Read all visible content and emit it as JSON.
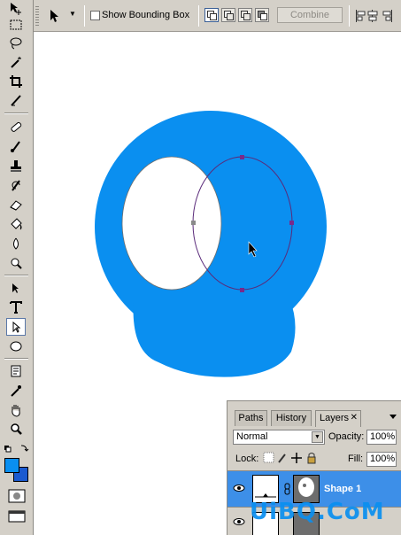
{
  "options_bar": {
    "tool_icon": "direct-selection-arrow-icon",
    "show_bounding_box_label": "Show Bounding Box",
    "show_bounding_box_checked": false,
    "path_modes": [
      "add-to-shape-area",
      "subtract-from-shape-area",
      "intersect-shape-areas",
      "exclude-overlapping-shape-areas"
    ],
    "combine_label": "Combine",
    "align_icons": "align-distribute-icons"
  },
  "toolbox": {
    "tools": [
      "move",
      "marquee",
      "lasso",
      "magic-wand",
      "crop",
      "slice",
      "healing-brush",
      "brush",
      "clone-stamp",
      "history-brush",
      "eraser",
      "paint-bucket",
      "blur",
      "dodge",
      "pen",
      "type",
      "direct-selection",
      "ellipse",
      "notes",
      "eyedropper",
      "hand",
      "zoom"
    ],
    "active_tool": "direct-selection",
    "foreground_color": "#0a8ff0",
    "background_color": "#1a5ad0"
  },
  "canvas": {
    "shape_color": "#0a8ff0",
    "background": "#ffffff"
  },
  "layers_panel": {
    "tabs": [
      {
        "label": "Paths",
        "active": false
      },
      {
        "label": "History",
        "active": false
      },
      {
        "label": "Layers",
        "active": true
      }
    ],
    "blend_mode": "Normal",
    "opacity_label": "Opacity:",
    "opacity_value": "100%",
    "lock_label": "Lock:",
    "fill_label": "Fill:",
    "fill_value": "100%",
    "layers": [
      {
        "name": "Shape 1",
        "selected": true,
        "visible": true
      },
      {
        "name": "",
        "selected": false,
        "visible": true
      }
    ]
  },
  "watermark": "UiBQ.CoM"
}
